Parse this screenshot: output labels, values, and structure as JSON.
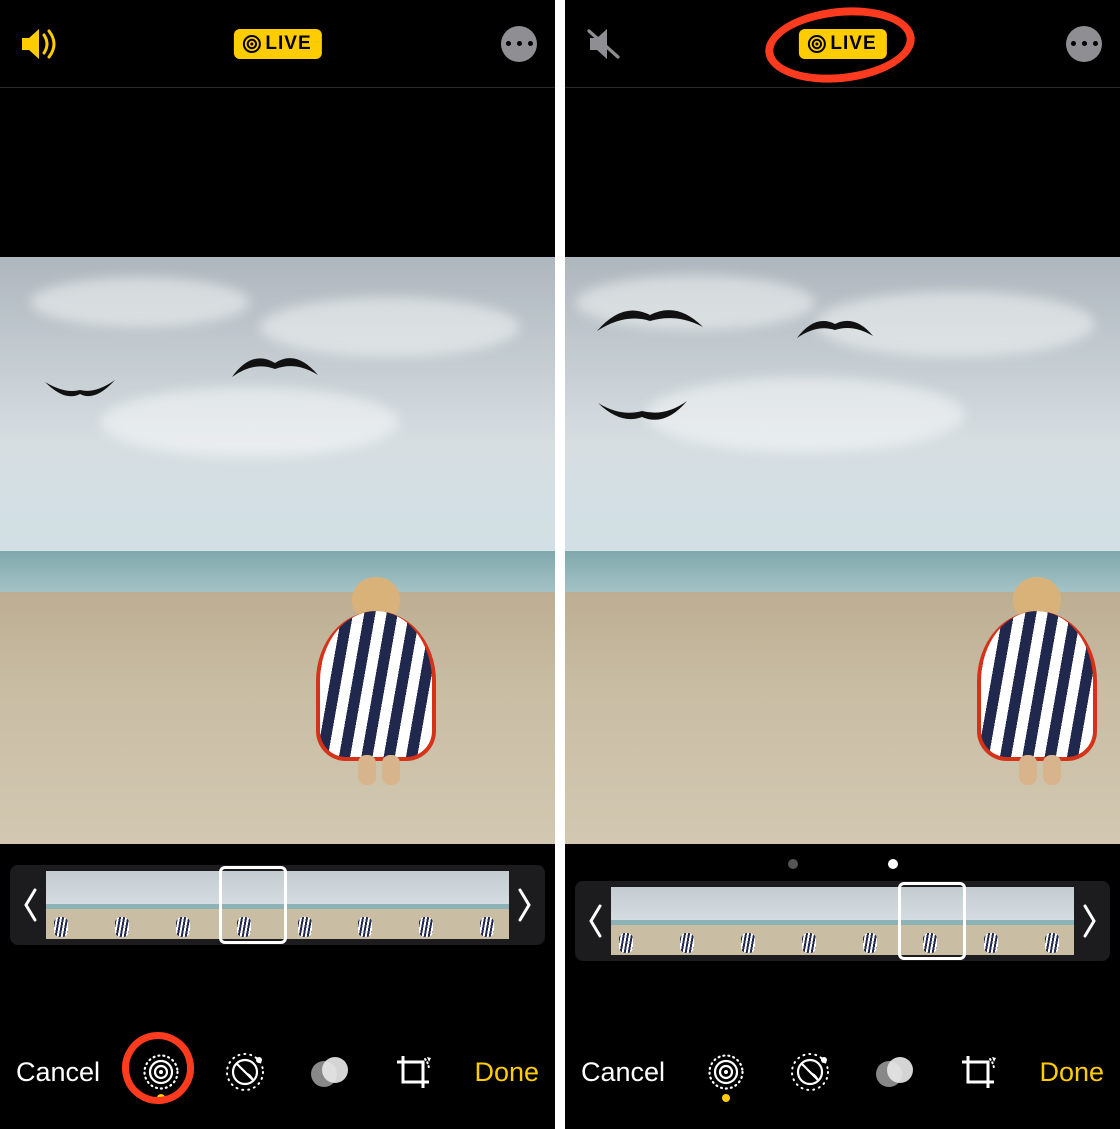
{
  "screens": [
    {
      "id": "left",
      "sound": "on",
      "live_label": "LIVE",
      "cancel_label": "Cancel",
      "done_label": "Done",
      "frame_count": 8,
      "selected_frame_index": 3,
      "show_dots": false,
      "active_tool": "live",
      "annotation": "tool-live",
      "kid_offset": "center"
    },
    {
      "id": "right",
      "sound": "off",
      "live_label": "LIVE",
      "cancel_label": "Cancel",
      "done_label": "Done",
      "frame_count": 8,
      "selected_frame_index": 5,
      "show_dots": true,
      "dot_active_index": 1,
      "active_tool": "live",
      "annotation": "live-badge",
      "kid_offset": "right"
    }
  ],
  "tools": [
    {
      "key": "live",
      "name": "live-photo-tool-icon"
    },
    {
      "key": "adjust",
      "name": "adjust-tool-icon"
    },
    {
      "key": "filters",
      "name": "filters-tool-icon"
    },
    {
      "key": "crop",
      "name": "crop-tool-icon"
    }
  ],
  "colors": {
    "accent": "#ffcc00",
    "annotation": "#ff3b1f"
  }
}
